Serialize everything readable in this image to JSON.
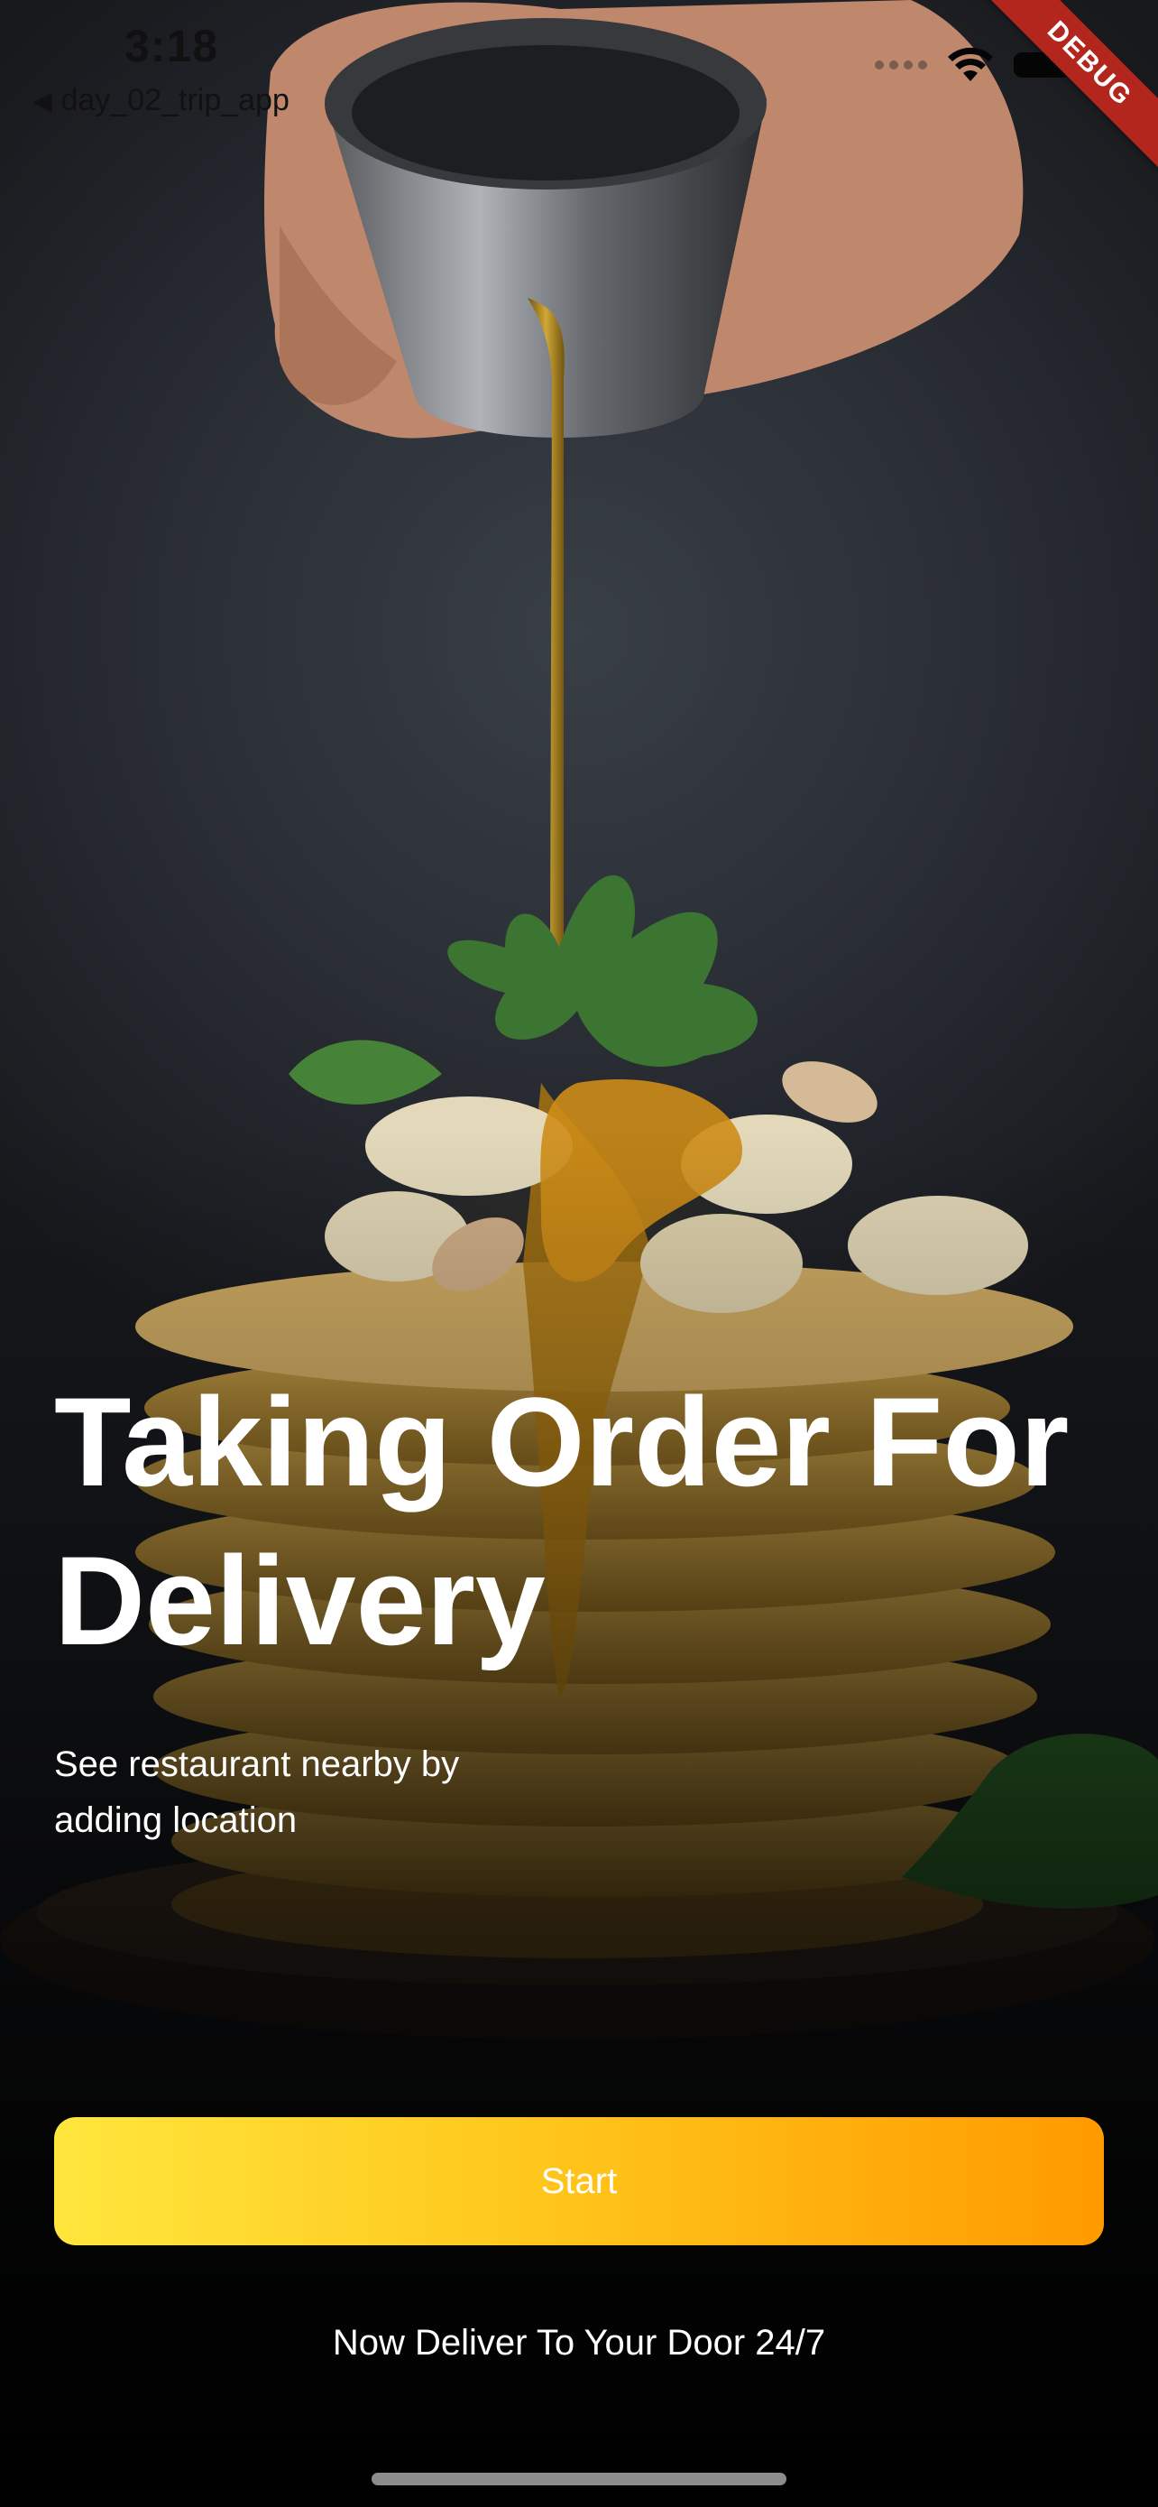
{
  "status_bar": {
    "time": "3:18",
    "back_app_label": "day_02_trip_app"
  },
  "debug_ribbon": {
    "label": "DEBUG"
  },
  "hero": {
    "image_description_icon": "pancake-stack-photo",
    "title": "Taking Order For Delivery",
    "subtitle": "See restaurant nearby by adding location"
  },
  "actions": {
    "start_label": "Start"
  },
  "footer": {
    "tagline": "Now Deliver To Your Door 24/7"
  },
  "colors": {
    "button_gradient_start": "#ffe63d",
    "button_gradient_end": "#ff9a00",
    "debug_ribbon": "#b3261e",
    "text": "#ffffff"
  }
}
